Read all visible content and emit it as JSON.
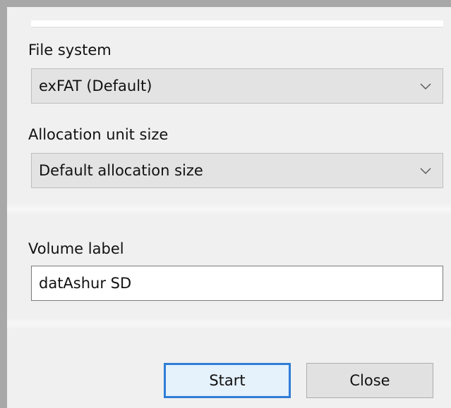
{
  "file_system": {
    "label": "File system",
    "selected": "exFAT (Default)",
    "chevron_icon": "chevron-down-icon"
  },
  "allocation_unit_size": {
    "label": "Allocation unit size",
    "selected": "Default allocation size",
    "chevron_icon": "chevron-down-icon"
  },
  "volume_label": {
    "label": "Volume label",
    "value": "datAshur SD"
  },
  "buttons": {
    "start_label": "Start",
    "close_label": "Close"
  },
  "colors": {
    "default_button_border": "#2f7dd6",
    "window_background": "#f0f0f0"
  }
}
